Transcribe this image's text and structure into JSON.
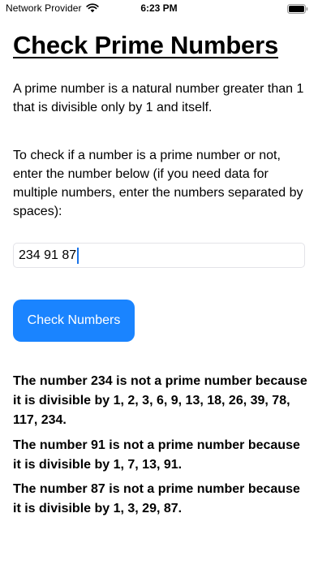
{
  "status_bar": {
    "carrier": "Network Provider",
    "time": "6:23 PM",
    "icons": [
      "wifi-icon",
      "battery-icon"
    ]
  },
  "main": {
    "title": "Check Prime Numbers",
    "intro": "A prime number is a natural number greater than 1 that is divisible only by 1 and itself.",
    "instructions": "To check if a number is a prime number or not, enter the number below (if you need data for multiple numbers, enter the numbers separated by spaces):",
    "input_value": "234 91 87",
    "button_label": "Check Numbers",
    "results": [
      "The number 234 is not a prime number because it is divisible by 1, 2, 3, 6, 9, 13, 18, 26, 39, 78, 117, 234.",
      "The number 91 is not a prime number because it is divisible by 1, 7, 13, 91.",
      "The number 87 is not a prime number because it is divisible by 1, 3, 29, 87."
    ]
  },
  "colors": {
    "accent": "#1a84ff",
    "caret": "#1a73e8",
    "input_border": "#e3e3e8",
    "text": "#000000"
  }
}
